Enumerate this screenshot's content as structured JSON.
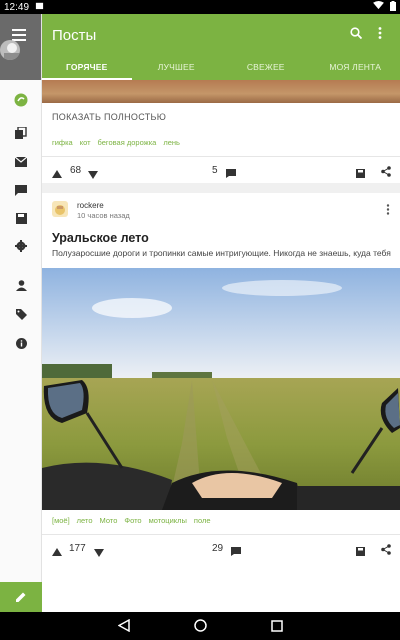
{
  "status_bar": {
    "time": "12:49"
  },
  "app_bar": {
    "title": "Посты"
  },
  "tabs": [
    {
      "label": "ГОРЯЧЕЕ",
      "active": true
    },
    {
      "label": "ЛУЧШЕЕ",
      "active": false
    },
    {
      "label": "СВЕЖЕЕ",
      "active": false
    },
    {
      "label": "МОЯ ЛЕНТА",
      "active": false
    }
  ],
  "sidebar": {
    "items": [
      "feed-icon",
      "copy-icon",
      "mail-icon",
      "comments-icon",
      "saved-icon",
      "settings-icon",
      "profile-icon",
      "tag-icon",
      "info-icon"
    ]
  },
  "post1": {
    "show_all": "ПОКАЗАТЬ ПОЛНОСТЬЮ",
    "tags": [
      "гифка",
      "кот",
      "беговая дорожка",
      "лень"
    ],
    "rating": "68",
    "comments": "5"
  },
  "post2": {
    "author": "rockere",
    "time_ago": "10 часов назад",
    "title": "Уральское лето",
    "excerpt": "Полузаросшие дороги и тропинки самые интригующие. Никогда не знаешь, куда тебя",
    "tags": [
      "[моё]",
      "лето",
      "Мото",
      "Фото",
      "мотоциклы",
      "поле"
    ],
    "rating": "177",
    "comments": "29"
  },
  "colors": {
    "accent": "#7cb342",
    "tag": "#7cb342",
    "statusbar": "#000000"
  }
}
